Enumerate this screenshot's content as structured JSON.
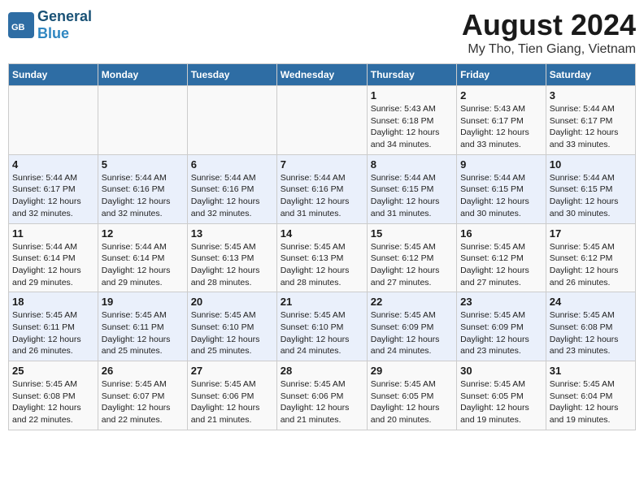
{
  "header": {
    "logo_general": "General",
    "logo_blue": "Blue",
    "title": "August 2024",
    "subtitle": "My Tho, Tien Giang, Vietnam"
  },
  "days_of_week": [
    "Sunday",
    "Monday",
    "Tuesday",
    "Wednesday",
    "Thursday",
    "Friday",
    "Saturday"
  ],
  "weeks": [
    [
      {
        "num": "",
        "info": ""
      },
      {
        "num": "",
        "info": ""
      },
      {
        "num": "",
        "info": ""
      },
      {
        "num": "",
        "info": ""
      },
      {
        "num": "1",
        "info": "Sunrise: 5:43 AM\nSunset: 6:18 PM\nDaylight: 12 hours\nand 34 minutes."
      },
      {
        "num": "2",
        "info": "Sunrise: 5:43 AM\nSunset: 6:17 PM\nDaylight: 12 hours\nand 33 minutes."
      },
      {
        "num": "3",
        "info": "Sunrise: 5:44 AM\nSunset: 6:17 PM\nDaylight: 12 hours\nand 33 minutes."
      }
    ],
    [
      {
        "num": "4",
        "info": "Sunrise: 5:44 AM\nSunset: 6:17 PM\nDaylight: 12 hours\nand 32 minutes."
      },
      {
        "num": "5",
        "info": "Sunrise: 5:44 AM\nSunset: 6:16 PM\nDaylight: 12 hours\nand 32 minutes."
      },
      {
        "num": "6",
        "info": "Sunrise: 5:44 AM\nSunset: 6:16 PM\nDaylight: 12 hours\nand 32 minutes."
      },
      {
        "num": "7",
        "info": "Sunrise: 5:44 AM\nSunset: 6:16 PM\nDaylight: 12 hours\nand 31 minutes."
      },
      {
        "num": "8",
        "info": "Sunrise: 5:44 AM\nSunset: 6:15 PM\nDaylight: 12 hours\nand 31 minutes."
      },
      {
        "num": "9",
        "info": "Sunrise: 5:44 AM\nSunset: 6:15 PM\nDaylight: 12 hours\nand 30 minutes."
      },
      {
        "num": "10",
        "info": "Sunrise: 5:44 AM\nSunset: 6:15 PM\nDaylight: 12 hours\nand 30 minutes."
      }
    ],
    [
      {
        "num": "11",
        "info": "Sunrise: 5:44 AM\nSunset: 6:14 PM\nDaylight: 12 hours\nand 29 minutes."
      },
      {
        "num": "12",
        "info": "Sunrise: 5:44 AM\nSunset: 6:14 PM\nDaylight: 12 hours\nand 29 minutes."
      },
      {
        "num": "13",
        "info": "Sunrise: 5:45 AM\nSunset: 6:13 PM\nDaylight: 12 hours\nand 28 minutes."
      },
      {
        "num": "14",
        "info": "Sunrise: 5:45 AM\nSunset: 6:13 PM\nDaylight: 12 hours\nand 28 minutes."
      },
      {
        "num": "15",
        "info": "Sunrise: 5:45 AM\nSunset: 6:12 PM\nDaylight: 12 hours\nand 27 minutes."
      },
      {
        "num": "16",
        "info": "Sunrise: 5:45 AM\nSunset: 6:12 PM\nDaylight: 12 hours\nand 27 minutes."
      },
      {
        "num": "17",
        "info": "Sunrise: 5:45 AM\nSunset: 6:12 PM\nDaylight: 12 hours\nand 26 minutes."
      }
    ],
    [
      {
        "num": "18",
        "info": "Sunrise: 5:45 AM\nSunset: 6:11 PM\nDaylight: 12 hours\nand 26 minutes."
      },
      {
        "num": "19",
        "info": "Sunrise: 5:45 AM\nSunset: 6:11 PM\nDaylight: 12 hours\nand 25 minutes."
      },
      {
        "num": "20",
        "info": "Sunrise: 5:45 AM\nSunset: 6:10 PM\nDaylight: 12 hours\nand 25 minutes."
      },
      {
        "num": "21",
        "info": "Sunrise: 5:45 AM\nSunset: 6:10 PM\nDaylight: 12 hours\nand 24 minutes."
      },
      {
        "num": "22",
        "info": "Sunrise: 5:45 AM\nSunset: 6:09 PM\nDaylight: 12 hours\nand 24 minutes."
      },
      {
        "num": "23",
        "info": "Sunrise: 5:45 AM\nSunset: 6:09 PM\nDaylight: 12 hours\nand 23 minutes."
      },
      {
        "num": "24",
        "info": "Sunrise: 5:45 AM\nSunset: 6:08 PM\nDaylight: 12 hours\nand 23 minutes."
      }
    ],
    [
      {
        "num": "25",
        "info": "Sunrise: 5:45 AM\nSunset: 6:08 PM\nDaylight: 12 hours\nand 22 minutes."
      },
      {
        "num": "26",
        "info": "Sunrise: 5:45 AM\nSunset: 6:07 PM\nDaylight: 12 hours\nand 22 minutes."
      },
      {
        "num": "27",
        "info": "Sunrise: 5:45 AM\nSunset: 6:06 PM\nDaylight: 12 hours\nand 21 minutes."
      },
      {
        "num": "28",
        "info": "Sunrise: 5:45 AM\nSunset: 6:06 PM\nDaylight: 12 hours\nand 21 minutes."
      },
      {
        "num": "29",
        "info": "Sunrise: 5:45 AM\nSunset: 6:05 PM\nDaylight: 12 hours\nand 20 minutes."
      },
      {
        "num": "30",
        "info": "Sunrise: 5:45 AM\nSunset: 6:05 PM\nDaylight: 12 hours\nand 19 minutes."
      },
      {
        "num": "31",
        "info": "Sunrise: 5:45 AM\nSunset: 6:04 PM\nDaylight: 12 hours\nand 19 minutes."
      }
    ]
  ]
}
